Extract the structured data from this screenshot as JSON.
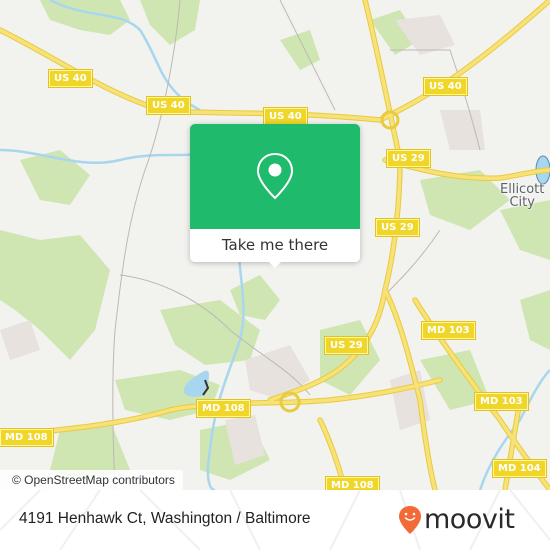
{
  "map": {
    "colors": {
      "land": "#f2f2ef",
      "park": "#cfe6b2",
      "water": "#a9d6ef",
      "highway": "#f4dc5c",
      "urban": "#e7e2de",
      "minor_road": "#bdb8b4"
    },
    "shields": [
      {
        "label": "US 40"
      },
      {
        "label": "US 40"
      },
      {
        "label": "US 40"
      },
      {
        "label": "US 40"
      },
      {
        "label": "US 29"
      },
      {
        "label": "US 29"
      },
      {
        "label": "US 29"
      },
      {
        "label": "MD 103"
      },
      {
        "label": "MD 103"
      },
      {
        "label": "MD 108"
      },
      {
        "label": "MD 108"
      },
      {
        "label": "MD 108"
      },
      {
        "label": "MD 104"
      }
    ],
    "places": [
      {
        "line1": "Ellicott",
        "line2": "City"
      }
    ],
    "attribution": "© OpenStreetMap contributors"
  },
  "popup": {
    "icon": "map-pin-icon",
    "button_label": "Take me there",
    "accent": "#1fba6c"
  },
  "footer": {
    "address": "4191 Henhawk Ct, Washington / Baltimore",
    "brand": "moovit",
    "brand_icon": "moovit-smiley-pin-icon",
    "brand_color": "#f26a38"
  }
}
